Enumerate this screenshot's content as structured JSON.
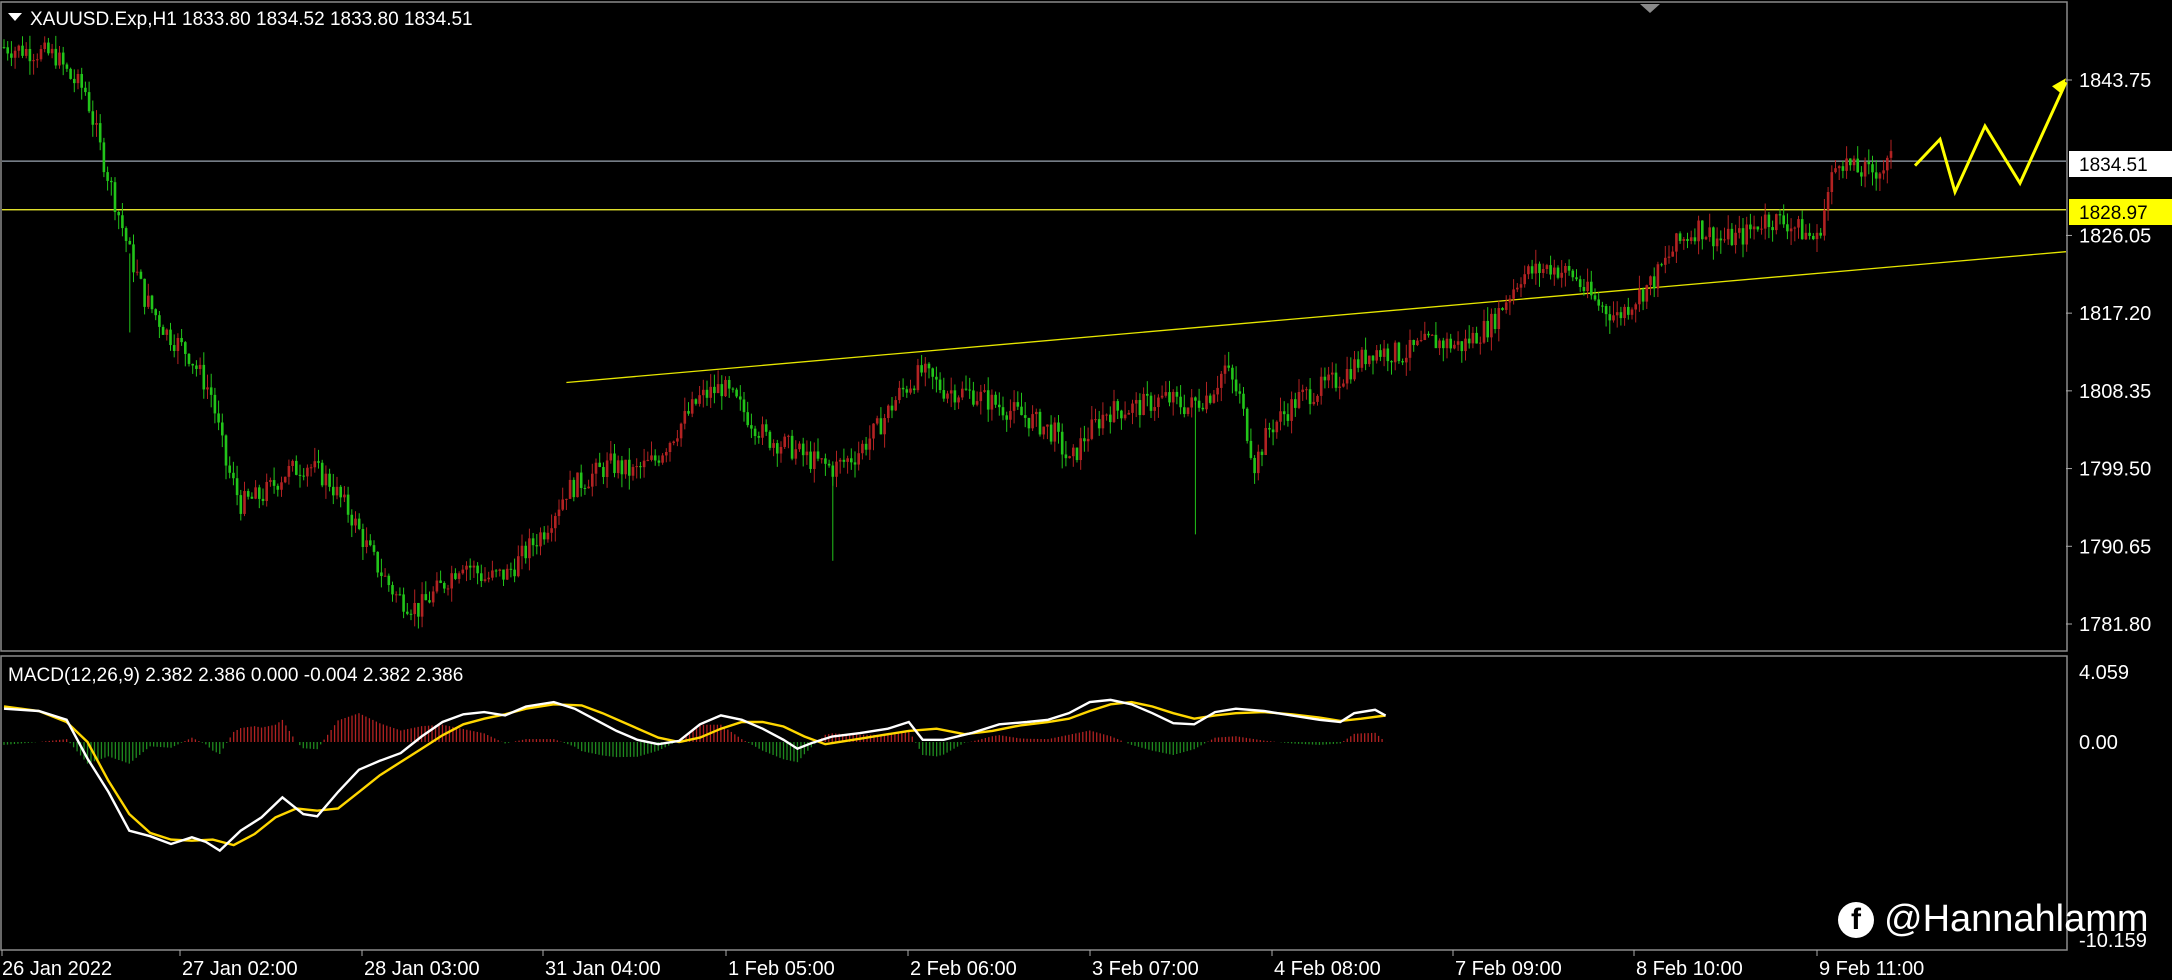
{
  "chart_data": [
    {
      "type": "candlestick",
      "title": "XAUUSD.Exp,H1  1833.80 1834.52 1833.80 1834.51",
      "symbol": "XAUUSD.Exp",
      "timeframe": "H1",
      "ohlc_header": {
        "open": 1833.8,
        "high": 1834.52,
        "low": 1833.8,
        "close": 1834.51
      },
      "ylim": [
        1776.0,
        1848.0
      ],
      "y_ticks": [
        "1843.75",
        "1826.05",
        "1817.20",
        "1808.35",
        "1799.50",
        "1790.65",
        "1781.80"
      ],
      "current_price_label": "1834.51",
      "horizontal_level_label": "1828.97",
      "horizontal_level": 1828.97,
      "current_price": 1834.51,
      "trendline": {
        "from": {
          "time": "1 Feb 05:00",
          "price": 1809.3
        },
        "to": {
          "time": "9 Feb 18:00",
          "price": 1824.2
        }
      },
      "x_ticks": [
        "26 Jan 2022",
        "27 Jan 02:00",
        "28 Jan 03:00",
        "31 Jan 04:00",
        "1 Feb 05:00",
        "2 Feb 06:00",
        "3 Feb 07:00",
        "4 Feb 08:00",
        "7 Feb 09:00",
        "8 Feb 10:00",
        "9 Feb 11:00"
      ],
      "close_path": [
        [
          0,
          1847.5
        ],
        [
          8,
          1847.0
        ],
        [
          14,
          1846.5
        ],
        [
          18,
          1844.0
        ],
        [
          22,
          1842.5
        ],
        [
          26,
          1836.0
        ],
        [
          30,
          1830.0
        ],
        [
          34,
          1824.0
        ],
        [
          38,
          1819.0
        ],
        [
          44,
          1815.0
        ],
        [
          50,
          1812.5
        ],
        [
          56,
          1808.0
        ],
        [
          60,
          1800.0
        ],
        [
          64,
          1795.5
        ],
        [
          70,
          1796.5
        ],
        [
          76,
          1799.0
        ],
        [
          82,
          1800.0
        ],
        [
          88,
          1798.0
        ],
        [
          94,
          1794.0
        ],
        [
          100,
          1789.0
        ],
        [
          106,
          1785.0
        ],
        [
          112,
          1783.5
        ],
        [
          118,
          1786.0
        ],
        [
          124,
          1789.0
        ],
        [
          130,
          1787.0
        ],
        [
          136,
          1787.5
        ],
        [
          140,
          1789.5
        ],
        [
          146,
          1792.5
        ],
        [
          152,
          1797.0
        ],
        [
          158,
          1798.5
        ],
        [
          164,
          1800.0
        ],
        [
          170,
          1799.0
        ],
        [
          176,
          1800.5
        ],
        [
          182,
          1804.0
        ],
        [
          188,
          1807.5
        ],
        [
          194,
          1808.8
        ],
        [
          200,
          1806.0
        ],
        [
          206,
          1803.0
        ],
        [
          212,
          1802.0
        ],
        [
          218,
          1800.5
        ],
        [
          224,
          1799.5
        ],
        [
          230,
          1801.0
        ],
        [
          236,
          1804.0
        ],
        [
          242,
          1808.0
        ],
        [
          248,
          1810.5
        ],
        [
          254,
          1808.5
        ],
        [
          262,
          1808.0
        ],
        [
          270,
          1806.5
        ],
        [
          278,
          1805.0
        ],
        [
          284,
          1803.5
        ],
        [
          288,
          1800.0
        ],
        [
          292,
          1803.0
        ],
        [
          298,
          1806.0
        ],
        [
          306,
          1806.5
        ],
        [
          314,
          1807.5
        ],
        [
          320,
          1806.5
        ],
        [
          326,
          1808.0
        ],
        [
          330,
          1811.0
        ],
        [
          334,
          1807.5
        ],
        [
          338,
          1800.0
        ],
        [
          342,
          1804.0
        ],
        [
          350,
          1807.5
        ],
        [
          360,
          1809.5
        ],
        [
          370,
          1813.0
        ],
        [
          378,
          1812.5
        ],
        [
          386,
          1814.0
        ],
        [
          394,
          1813.5
        ],
        [
          402,
          1816.0
        ],
        [
          410,
          1821.5
        ],
        [
          418,
          1822.5
        ],
        [
          424,
          1821.5
        ],
        [
          430,
          1818.5
        ],
        [
          436,
          1816.8
        ],
        [
          440,
          1818.5
        ],
        [
          446,
          1821.0
        ],
        [
          452,
          1825.0
        ],
        [
          458,
          1827.0
        ],
        [
          464,
          1825.5
        ],
        [
          470,
          1826.0
        ],
        [
          476,
          1828.0
        ],
        [
          482,
          1827.5
        ],
        [
          486,
          1826.5
        ],
        [
          490,
          1825.5
        ],
        [
          492,
          1829.0
        ],
        [
          494,
          1832.5
        ],
        [
          496,
          1835.0
        ],
        [
          500,
          1833.5
        ],
        [
          504,
          1833.2
        ],
        [
          508,
          1833.8
        ],
        [
          510,
          1834.51
        ]
      ],
      "forecast_arrow_path": [
        1834.0,
        1837.0,
        1831.0,
        1838.5,
        1832.0,
        1843.5
      ]
    },
    {
      "type": "macd",
      "title": "MACD(12,26,9) 2.382 2.386 0.000 -0.004 2.382 2.386",
      "params": "12,26,9",
      "values": [
        2.382,
        2.386,
        0.0,
        -0.004,
        2.382,
        2.386
      ],
      "ylim": [
        -10.159,
        4.059
      ],
      "y_ticks": [
        "4.059",
        "0.00",
        "-10.159"
      ],
      "macd_line": [
        [
          0,
          3.0
        ],
        [
          10,
          2.8
        ],
        [
          18,
          2.0
        ],
        [
          24,
          -1.5
        ],
        [
          30,
          -4.5
        ],
        [
          36,
          -8.0
        ],
        [
          42,
          -8.5
        ],
        [
          48,
          -9.2
        ],
        [
          54,
          -8.6
        ],
        [
          58,
          -9.0
        ],
        [
          62,
          -9.8
        ],
        [
          68,
          -8.0
        ],
        [
          74,
          -6.8
        ],
        [
          80,
          -5.0
        ],
        [
          86,
          -6.5
        ],
        [
          90,
          -6.7
        ],
        [
          96,
          -4.5
        ],
        [
          102,
          -2.5
        ],
        [
          108,
          -1.7
        ],
        [
          114,
          -1.0
        ],
        [
          120,
          0.5
        ],
        [
          126,
          1.8
        ],
        [
          132,
          2.5
        ],
        [
          138,
          2.7
        ],
        [
          144,
          2.4
        ],
        [
          150,
          3.2
        ],
        [
          158,
          3.6
        ],
        [
          164,
          3.0
        ],
        [
          170,
          2.0
        ],
        [
          176,
          1.0
        ],
        [
          182,
          0.2
        ],
        [
          188,
          -0.2
        ],
        [
          194,
          0.1
        ],
        [
          200,
          1.6
        ],
        [
          206,
          2.4
        ],
        [
          212,
          2.0
        ],
        [
          218,
          1.2
        ],
        [
          224,
          0.2
        ],
        [
          228,
          -0.6
        ],
        [
          232,
          -0.1
        ],
        [
          238,
          0.5
        ],
        [
          246,
          0.8
        ],
        [
          254,
          1.2
        ],
        [
          260,
          1.8
        ],
        [
          264,
          0.2
        ],
        [
          270,
          0.2
        ],
        [
          278,
          0.8
        ],
        [
          286,
          1.6
        ],
        [
          294,
          1.8
        ],
        [
          300,
          2.0
        ],
        [
          306,
          2.6
        ],
        [
          312,
          3.6
        ],
        [
          318,
          3.8
        ],
        [
          324,
          3.4
        ],
        [
          330,
          2.6
        ],
        [
          336,
          1.7
        ],
        [
          342,
          1.6
        ],
        [
          348,
          2.7
        ],
        [
          354,
          3.0
        ],
        [
          362,
          2.8
        ],
        [
          370,
          2.4
        ],
        [
          378,
          2.0
        ],
        [
          384,
          1.8
        ],
        [
          388,
          2.6
        ],
        [
          394,
          2.9
        ],
        [
          397,
          2.382
        ]
      ],
      "signal_line": [
        [
          0,
          3.2
        ],
        [
          10,
          2.8
        ],
        [
          18,
          1.8
        ],
        [
          24,
          0.0
        ],
        [
          30,
          -3.5
        ],
        [
          36,
          -6.5
        ],
        [
          42,
          -8.2
        ],
        [
          48,
          -8.8
        ],
        [
          54,
          -8.9
        ],
        [
          60,
          -8.8
        ],
        [
          66,
          -9.3
        ],
        [
          72,
          -8.3
        ],
        [
          78,
          -6.8
        ],
        [
          84,
          -6.0
        ],
        [
          90,
          -6.2
        ],
        [
          96,
          -6.0
        ],
        [
          102,
          -4.5
        ],
        [
          108,
          -3.0
        ],
        [
          114,
          -1.8
        ],
        [
          120,
          -0.6
        ],
        [
          126,
          0.6
        ],
        [
          132,
          1.6
        ],
        [
          138,
          2.1
        ],
        [
          144,
          2.5
        ],
        [
          150,
          3.0
        ],
        [
          158,
          3.4
        ],
        [
          166,
          3.3
        ],
        [
          172,
          2.6
        ],
        [
          180,
          1.5
        ],
        [
          188,
          0.4
        ],
        [
          194,
          0.0
        ],
        [
          200,
          0.4
        ],
        [
          206,
          1.2
        ],
        [
          212,
          1.8
        ],
        [
          218,
          1.8
        ],
        [
          224,
          1.4
        ],
        [
          230,
          0.5
        ],
        [
          236,
          -0.2
        ],
        [
          244,
          0.2
        ],
        [
          252,
          0.6
        ],
        [
          260,
          1.0
        ],
        [
          268,
          1.2
        ],
        [
          276,
          0.7
        ],
        [
          284,
          1.0
        ],
        [
          292,
          1.5
        ],
        [
          300,
          1.8
        ],
        [
          306,
          2.1
        ],
        [
          312,
          2.8
        ],
        [
          318,
          3.4
        ],
        [
          324,
          3.6
        ],
        [
          330,
          3.2
        ],
        [
          336,
          2.6
        ],
        [
          342,
          2.1
        ],
        [
          348,
          2.4
        ],
        [
          354,
          2.6
        ],
        [
          362,
          2.7
        ],
        [
          370,
          2.5
        ],
        [
          378,
          2.2
        ],
        [
          384,
          1.9
        ],
        [
          390,
          2.1
        ],
        [
          397,
          2.386
        ]
      ]
    }
  ],
  "colors": {
    "background": "#000000",
    "bull_candle": "#b22222",
    "bear_candle": "#22c41a",
    "macd_line": "#ffffff",
    "signal_line": "#ffd700",
    "level_line": "#ffff33",
    "price_line": "#9aa5b1",
    "trendline": "#e6e600",
    "forecast_arrow": "#ffff00",
    "hist_pos": "#b22222",
    "hist_neg": "#1f8a1f"
  },
  "watermark": {
    "icon": "facebook-icon",
    "icon_glyph": "f",
    "text": "@Hannahlamm"
  }
}
